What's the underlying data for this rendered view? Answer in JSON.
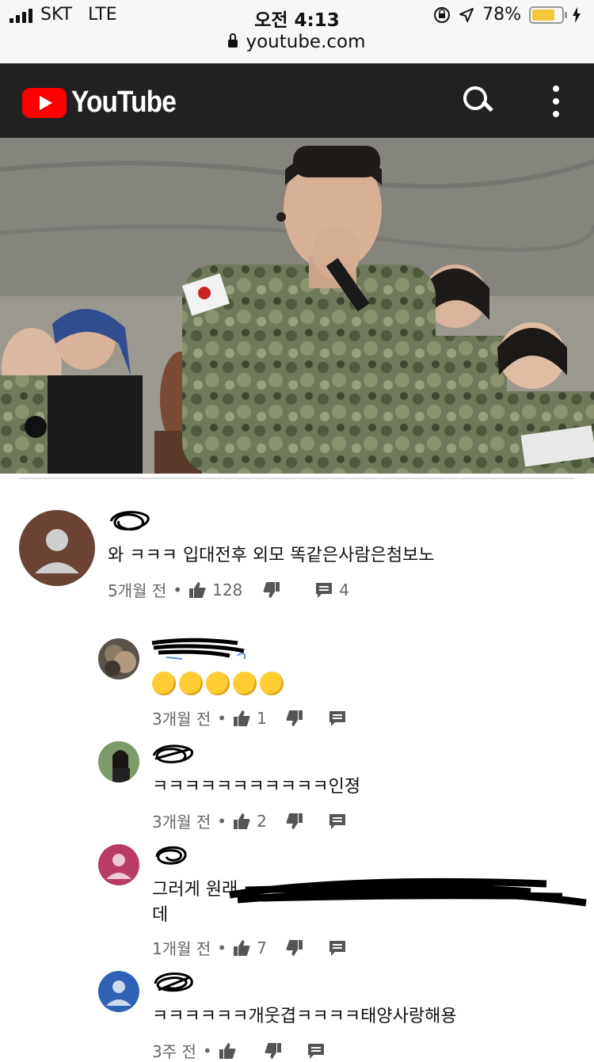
{
  "status_bar": {
    "carrier": "SKT",
    "network": "LTE",
    "time": "오전 4:13",
    "battery_percent": "78%",
    "battery_level": 0.78
  },
  "browser": {
    "url": "youtube.com"
  },
  "header": {
    "logo_text": "YouTube",
    "icons": [
      "search-icon",
      "more-vert-icon"
    ]
  },
  "comments": [
    {
      "text": "와 ㅋㅋㅋ 입대전후 외모 똑같은사람은첨보노",
      "time": "5개월 전",
      "likes": "128",
      "replies": "4"
    }
  ],
  "replies": [
    {
      "text": "",
      "emoji_count": 5,
      "time": "3개월 전",
      "likes": "1"
    },
    {
      "text": "ㅋㅋㅋㅋㅋㅋㅋㅋㅋㅋㅋ인졍",
      "time": "3개월 전",
      "likes": "2"
    },
    {
      "text_line1": "그러게 원래",
      "text_line2": "데",
      "time": "1개월 전",
      "likes": "7"
    },
    {
      "text": "ㅋㅋㅋㅋㅋㅋ개웃겹ㅋㅋㅋㅋ태양사랑해용",
      "time": "3주 전",
      "likes": ""
    }
  ],
  "colors": {
    "header_bg": "#212121",
    "brand_red": "#ff0000",
    "battery": "#f3c93b"
  }
}
